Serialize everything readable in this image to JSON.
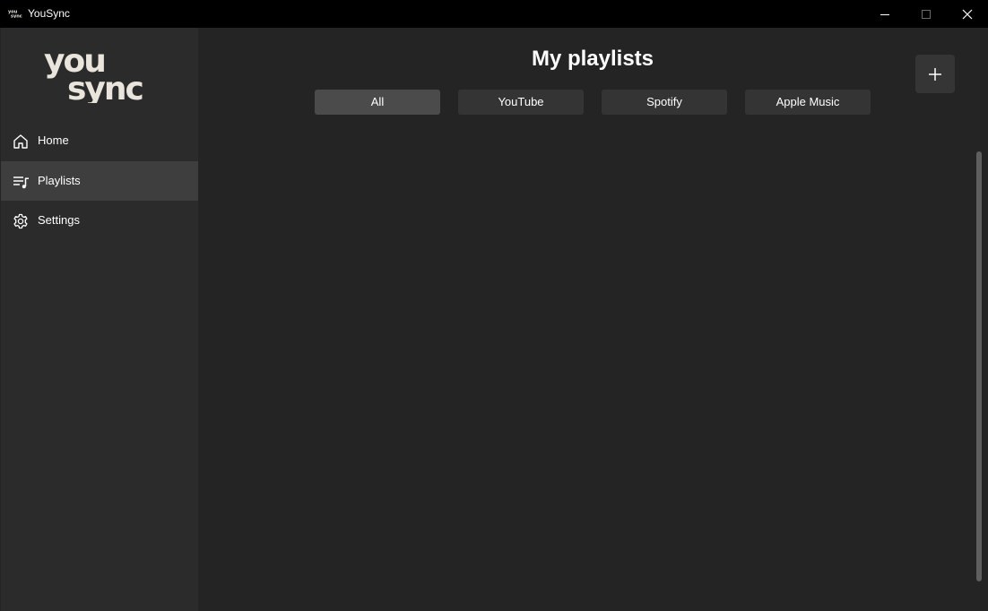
{
  "window": {
    "title": "YouSync"
  },
  "sidebar": {
    "logo": {
      "line1": "you",
      "line2": "sync"
    },
    "items": [
      {
        "label": "Home",
        "icon": "home-icon",
        "selected": false
      },
      {
        "label": "Playlists",
        "icon": "playlist-icon",
        "selected": true
      },
      {
        "label": "Settings",
        "icon": "gear-icon",
        "selected": false
      }
    ]
  },
  "main": {
    "title": "My playlists",
    "add_button_icon": "plus-icon",
    "filters": [
      {
        "label": "All",
        "selected": true
      },
      {
        "label": "YouTube",
        "selected": false
      },
      {
        "label": "Spotify",
        "selected": false
      },
      {
        "label": "Apple Music",
        "selected": false
      }
    ]
  },
  "colors": {
    "titlebar": "#000000",
    "sidebar": "#2b2b2b",
    "sidebar_selected": "#3e3e3e",
    "content": "#242424",
    "filter": "#343434",
    "filter_selected": "#4b4b4b",
    "logo": "#e9e4dc"
  }
}
